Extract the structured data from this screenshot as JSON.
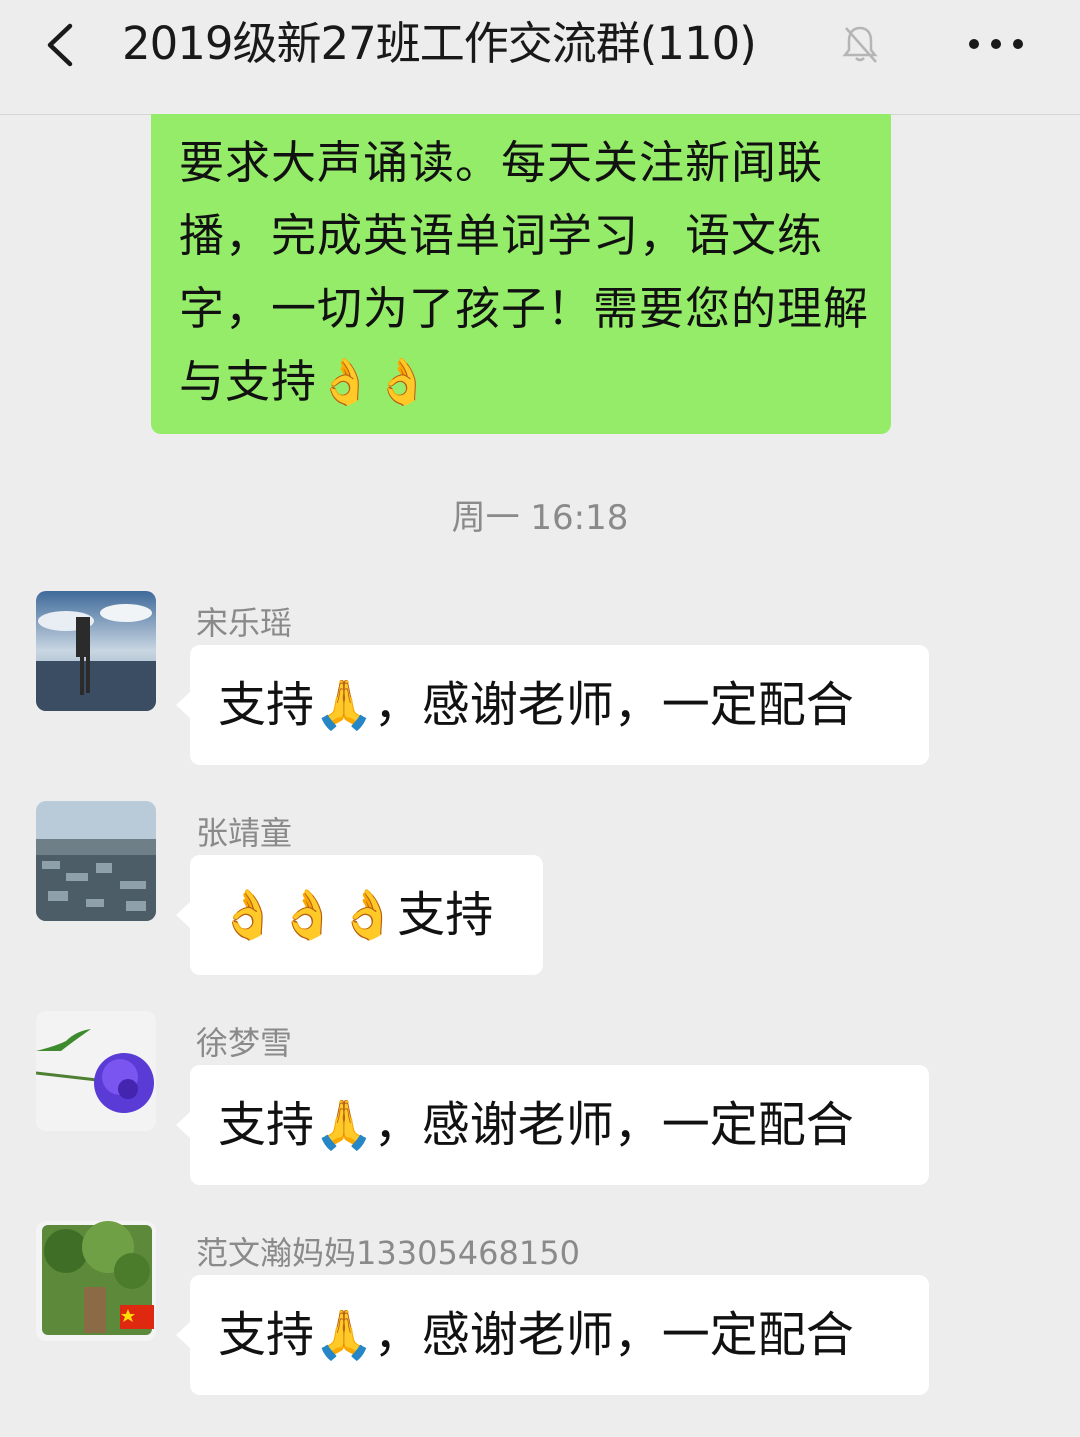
{
  "header": {
    "title": "2019级新27班工作交流群(110)",
    "back_icon": "chevron-left-icon",
    "mute_icon": "bell-off-icon",
    "more_icon": "ellipsis-icon"
  },
  "messages_top": {
    "text": "要求大声诵读。每天关注新闻联播，完成英语单词学习，语文练字，一切为了孩子！需要您的理解与支持👌👌",
    "bubble_color": "#95ec69"
  },
  "timestamp": "周一 16:18",
  "messages": [
    {
      "sender": "宋乐瑶",
      "text": "支持🙏，感谢老师，一定配合",
      "avatar": "avatar-person-lake"
    },
    {
      "sender": "张靖童",
      "text": "👌👌👌支持",
      "avatar": "avatar-city-aerial"
    },
    {
      "sender": "徐梦雪",
      "text": "支持🙏，感谢老师，一定配合",
      "avatar": "avatar-purple-rose"
    },
    {
      "sender": "范文瀚妈妈13305468150",
      "text": "支持🙏，感谢老师，一定配合",
      "avatar": "avatar-tree"
    }
  ],
  "colors": {
    "background": "#ededed",
    "incoming_bubble": "#ffffff",
    "outgoing_bubble": "#95ec69"
  }
}
